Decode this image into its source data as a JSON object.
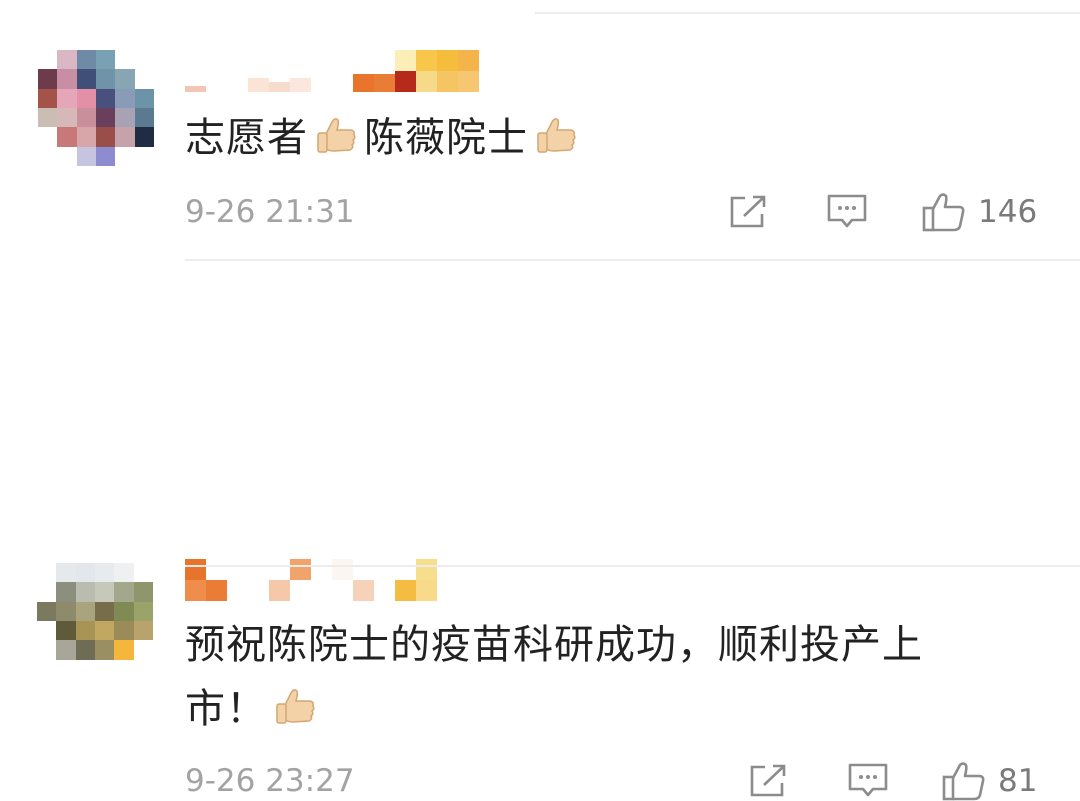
{
  "comments": [
    {
      "text_before": "志愿者",
      "text_middle": "陈薇院士",
      "timestamp": "9-26 21:31",
      "like_count": "146",
      "icons": [
        "share-icon",
        "comment-icon",
        "like-icon",
        "thumbs-up-emoji"
      ]
    },
    {
      "text_line1": "预祝陈院士的疫苗科研成功，顺利投产上",
      "text_line2": "市！",
      "timestamp": "9-26 23:27",
      "like_count": "81",
      "icons": [
        "share-icon",
        "comment-icon",
        "like-icon",
        "thumbs-up-emoji"
      ]
    }
  ],
  "colors": {
    "text": "#222222",
    "meta": "#a3a3a3",
    "icon": "#8c8c8c",
    "divider": "#ececec"
  }
}
